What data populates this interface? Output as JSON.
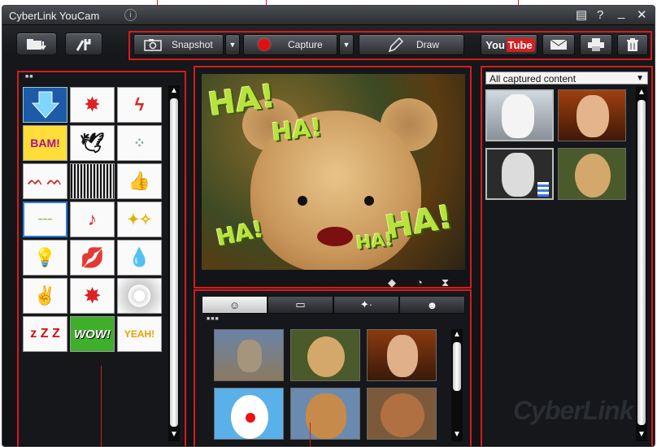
{
  "window": {
    "title": "CyberLink YouCam"
  },
  "titlebar_icons": [
    "skin-icon",
    "help-icon",
    "minimize-icon",
    "close-icon"
  ],
  "titlebar_glyphs": {
    "help": "?",
    "minimize": "_",
    "close": "✕",
    "skin": "▤"
  },
  "toolbar": {
    "snapshot_label": "Snapshot",
    "capture_label": "Capture",
    "draw_label": "Draw",
    "youtube_label": "You Tube"
  },
  "effects": {
    "panel_dots": "■■",
    "items": [
      "",
      "",
      "",
      "BAM!",
      "",
      "",
      "",
      "",
      "",
      "",
      "",
      "",
      "",
      "",
      "",
      "",
      "",
      "",
      "",
      "WOW!",
      "YEAH!"
    ]
  },
  "preview": {
    "haha": [
      "HA!",
      "HA!",
      "HA!",
      "HA!",
      "HA!"
    ]
  },
  "tabs": [
    "avatar-tab",
    "frame-tab",
    "particle-tab",
    "emotion-tab"
  ],
  "avatar_panel": {
    "dots": "■■■"
  },
  "library": {
    "filter": "All captured content",
    "brand": "CyberLink"
  },
  "colors": {
    "accent_red": "#d81b1b",
    "capture_red": "#e01010",
    "haha_green": "#b8e23c"
  }
}
